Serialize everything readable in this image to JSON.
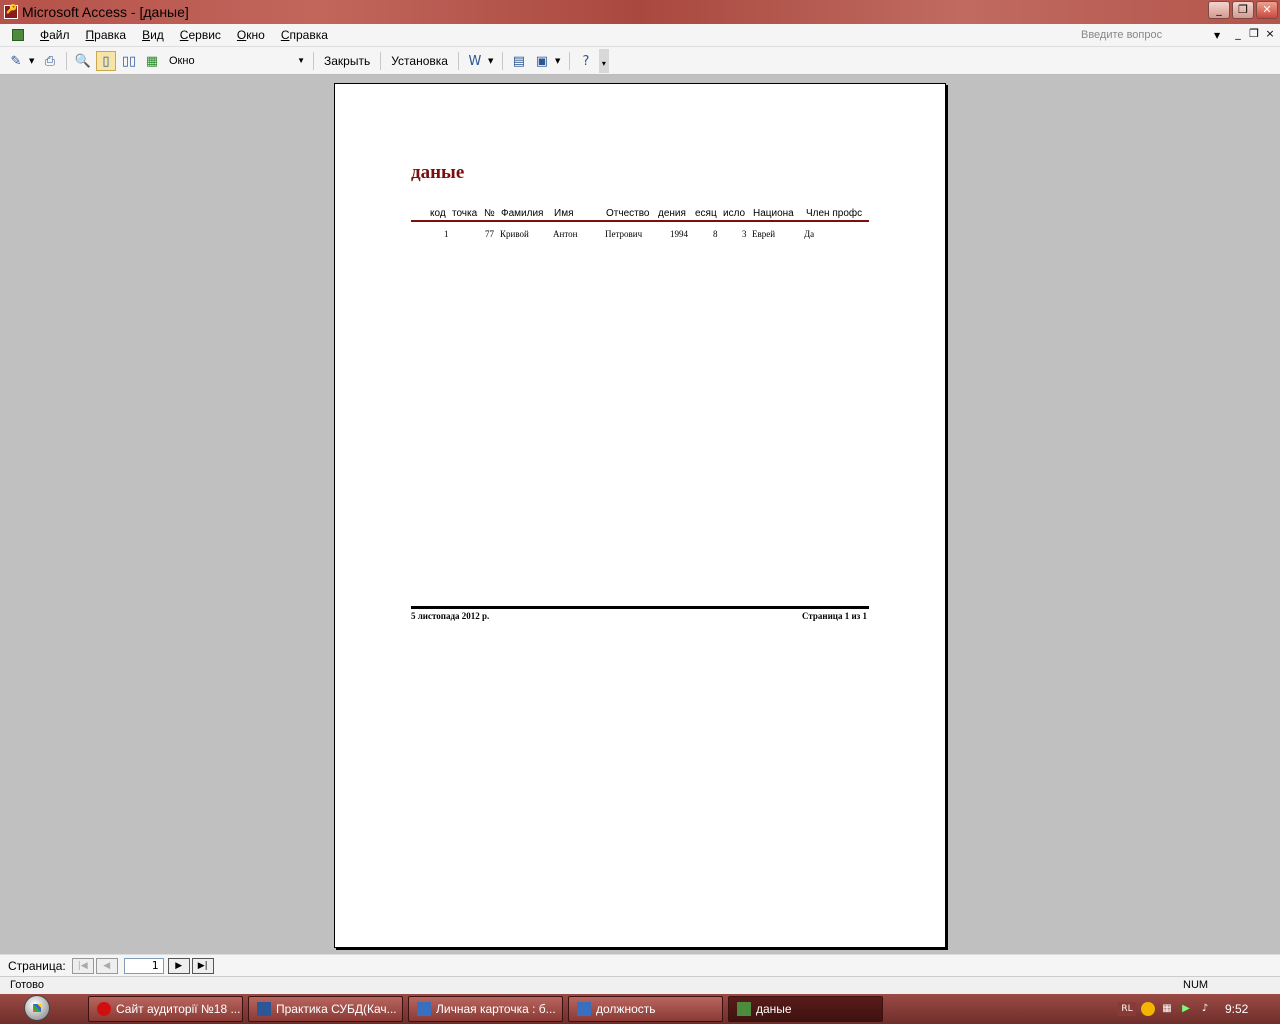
{
  "window": {
    "title": "Microsoft Access - [даные]",
    "minimize": "_",
    "restore": "❐",
    "close": "✕"
  },
  "menu": {
    "items": [
      "Файл",
      "Правка",
      "Вид",
      "Сервис",
      "Окно",
      "Справка"
    ],
    "help_placeholder": "Введите вопрос",
    "mdi_min": "_",
    "mdi_restore": "❐",
    "mdi_close": "×"
  },
  "toolbar": {
    "zoom_value": "Окно",
    "close_label": "Закрыть",
    "setup_label": "Установка"
  },
  "report": {
    "title": "даные",
    "headers": [
      "код",
      "точка",
      "№",
      "Фамилия",
      "Имя",
      "Отчество",
      "дения",
      "есяц",
      "исло",
      "Национа",
      "Член профс"
    ],
    "rows": [
      [
        "1",
        "77",
        "Кривой",
        "Антон",
        "Петрович",
        "1994",
        "8",
        "3",
        "Еврей",
        "Да"
      ]
    ],
    "footer_date": "5 листопада 2012 р.",
    "footer_page": "Страница 1 из 1"
  },
  "page_nav": {
    "label": "Страница:",
    "current": "1"
  },
  "status": {
    "text": "Готово",
    "num": "NUM"
  },
  "taskbar": {
    "tasks": [
      {
        "label": "Сайт аудиторії №18 ...",
        "icon_color": "#d01010"
      },
      {
        "label": "Практика СУБД(Кач...",
        "icon_color": "#2b5797"
      },
      {
        "label": "Личная карточка : б...",
        "icon_color": "#3a6fbf"
      },
      {
        "label": "должность",
        "icon_color": "#3a6fbf"
      },
      {
        "label": "даные",
        "icon_color": "#4b8b3b"
      }
    ],
    "tray_lang": "RL",
    "clock": "9:52"
  }
}
